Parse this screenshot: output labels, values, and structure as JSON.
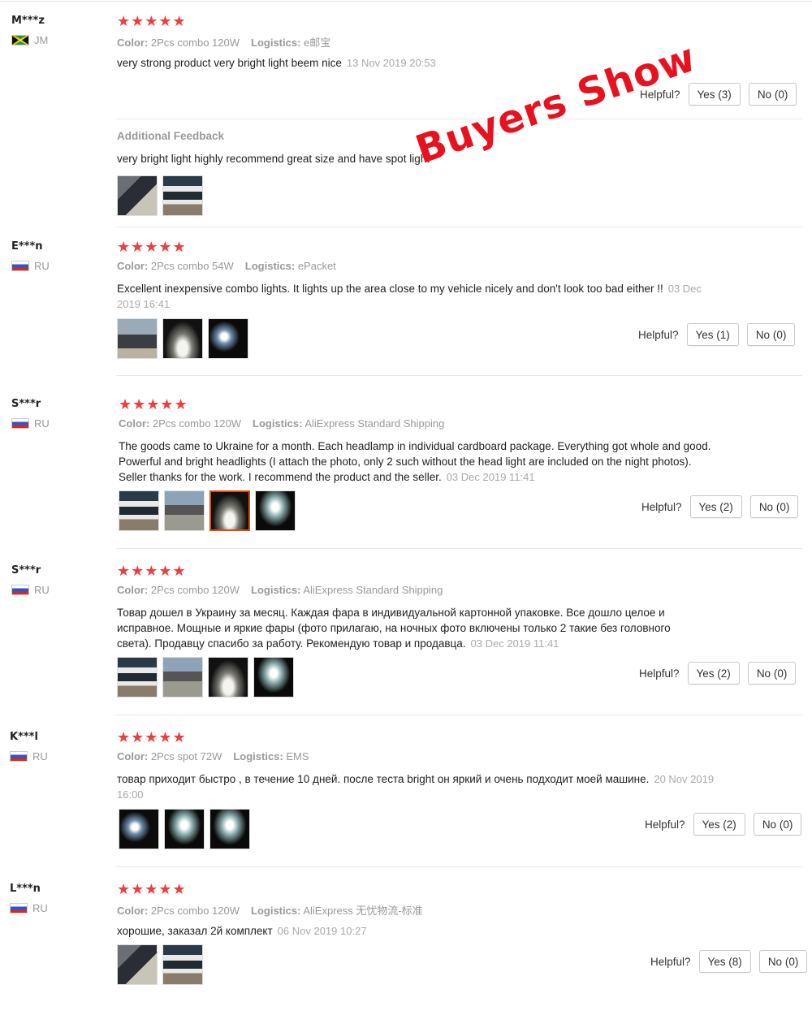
{
  "overlay_text": "Buyers Show",
  "helpful_label": "Helpful?",
  "reviews": [
    {
      "user": "M***z",
      "country": "JM",
      "flag": "jm-flag-icon",
      "stars": "★★★★★",
      "color_label": "Color:",
      "color": "2Pcs combo 120W",
      "logistics_label": "Logistics:",
      "logistics": "e邮宝",
      "text": "very strong product very bright light beem nice",
      "date": "13 Nov 2019 20:53",
      "yes": "Yes (3)",
      "no": "No (0)",
      "additional_label": "Additional Feedback",
      "additional_text": "very bright light highly recommend great size and have spot light"
    },
    {
      "user": "E***n",
      "country": "RU",
      "flag": "ru-flag-icon",
      "stars": "★★★★★",
      "color_label": "Color:",
      "color": "2Pcs combo 54W",
      "logistics_label": "Logistics:",
      "logistics": "ePacket",
      "text": "Excellent inexpensive combo lights. It lights up the area close to my vehicle nicely and don't look too bad either !!",
      "date": "03 Dec 2019 16:41",
      "yes": "Yes (1)",
      "no": "No (0)"
    },
    {
      "user": "S***r",
      "country": "RU",
      "flag": "ru-flag-icon",
      "stars": "★★★★★",
      "color_label": "Color:",
      "color": "2Pcs combo 120W",
      "logistics_label": "Logistics:",
      "logistics": "AliExpress Standard Shipping",
      "text": "The goods came to Ukraine for a month. Each headlamp in individual cardboard package. Everything got whole and good. Powerful and bright headlights (I attach the photo, only 2 such without the head light are included on the night photos). Seller thanks for the work. I recommend the product and the seller.",
      "date": "03 Dec 2019 11:41",
      "yes": "Yes (2)",
      "no": "No (0)"
    },
    {
      "user": "S***r",
      "country": "RU",
      "flag": "ru-flag-icon",
      "stars": "★★★★★",
      "color_label": "Color:",
      "color": "2Pcs combo 120W",
      "logistics_label": "Logistics:",
      "logistics": "AliExpress Standard Shipping",
      "text": "Товар дошел в Украину за месяц. Каждая фара в индивидуальной картонной упаковке. Все дошло целое и исправное. Мощные и яркие фары (фото прилагаю, на ночных фото включены только 2 такие без головного света). Продавцу спасибо за работу. Рекомендую товар и продавца.",
      "date": "03 Dec 2019 11:41",
      "yes": "Yes (2)",
      "no": "No (0)"
    },
    {
      "user": "K***l",
      "country": "RU",
      "flag": "ru-flag-icon",
      "stars": "★★★★★",
      "color_label": "Color:",
      "color": "2Pcs spot 72W",
      "logistics_label": "Logistics:",
      "logistics": "EMS",
      "text": "товар приходит быстро , в течение 10 дней. после теста bright он яркий и очень подходит моей машине.",
      "date": "20 Nov 2019 16:00",
      "yes": "Yes (2)",
      "no": "No (0)"
    },
    {
      "user": "L***n",
      "country": "RU",
      "flag": "ru-flag-icon",
      "stars": "★★★★★",
      "color_label": "Color:",
      "color": "2Pcs combo 120W",
      "logistics_label": "Logistics:",
      "logistics": "AliExpress 无忧物流-标准",
      "text": "хорошие, заказал 2й комплект",
      "date": "06 Nov 2019 10:27",
      "yes": "Yes (8)",
      "no": "No (0)"
    }
  ]
}
